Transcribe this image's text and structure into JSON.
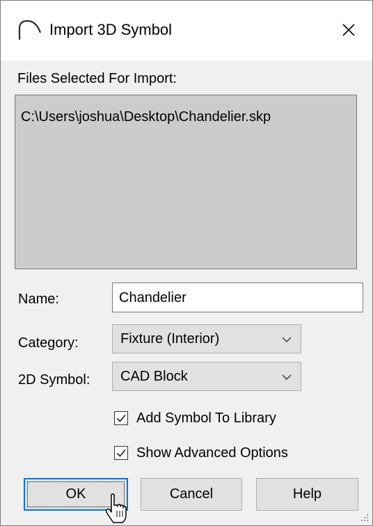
{
  "window": {
    "title": "Import 3D Symbol",
    "close_glyph": "✕"
  },
  "files": {
    "label": "Files Selected For Import:",
    "items": [
      "C:\\Users\\joshua\\Desktop\\Chandelier.skp"
    ]
  },
  "name_field": {
    "label": "Name:",
    "value": "Chandelier"
  },
  "category": {
    "label": "Category:",
    "selected": "Fixture (Interior)"
  },
  "symbol_2d": {
    "label": "2D Symbol:",
    "selected": "CAD Block"
  },
  "options": {
    "add_to_library": {
      "label": "Add Symbol To Library",
      "checked": true
    },
    "show_advanced": {
      "label": "Show Advanced Options",
      "checked": true
    }
  },
  "buttons": {
    "ok": "OK",
    "cancel": "Cancel",
    "help": "Help"
  },
  "colors": {
    "accent": "#0078d7",
    "dialog_bg": "#f0f0f0",
    "list_bg": "#cccccc"
  }
}
